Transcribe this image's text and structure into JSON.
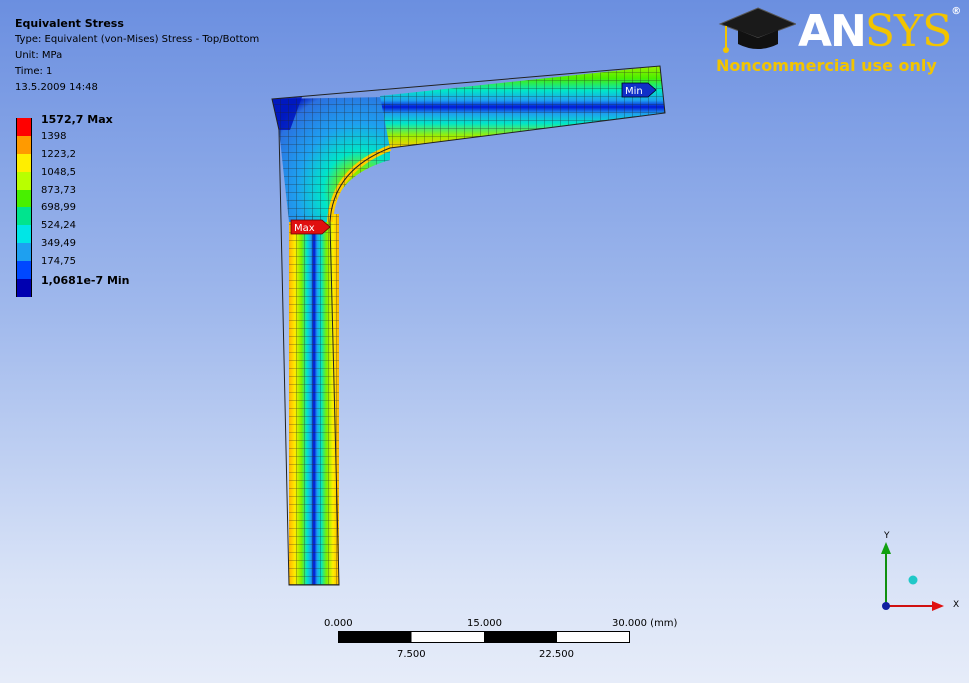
{
  "info": {
    "title": "Equivalent Stress",
    "type": "Type: Equivalent (von-Mises) Stress - Top/Bottom",
    "unit": "Unit: MPa",
    "time": "Time: 1",
    "date": "13.5.2009 14:48"
  },
  "legend": [
    {
      "label": "1572,7 Max",
      "color": "#ff0000",
      "bold": true
    },
    {
      "label": "1398",
      "color": "#ff9a00",
      "bold": false
    },
    {
      "label": "1223,2",
      "color": "#ffee00",
      "bold": false
    },
    {
      "label": "1048,5",
      "color": "#b9ff00",
      "bold": false
    },
    {
      "label": "873,73",
      "color": "#48f000",
      "bold": false
    },
    {
      "label": "698,99",
      "color": "#00e48e",
      "bold": false
    },
    {
      "label": "524,24",
      "color": "#00e6e6",
      "bold": false
    },
    {
      "label": "349,49",
      "color": "#1ea0f0",
      "bold": false
    },
    {
      "label": "174,75",
      "color": "#0048ff",
      "bold": false
    },
    {
      "label": "1,0681e-7 Min",
      "color": "#0000b0",
      "bold": true
    }
  ],
  "logo": {
    "word_an": "AN",
    "word_sys": "SYS",
    "registered": "®",
    "subtitle": "Noncommercial use only"
  },
  "markers": {
    "max": "Max",
    "min": "Min"
  },
  "scale": {
    "top_labels": [
      "0.000",
      "15.000",
      "30.000 (mm)"
    ],
    "bottom_labels": [
      "7.500",
      "22.500"
    ]
  },
  "triad": {
    "x": "X",
    "y": "Y"
  }
}
